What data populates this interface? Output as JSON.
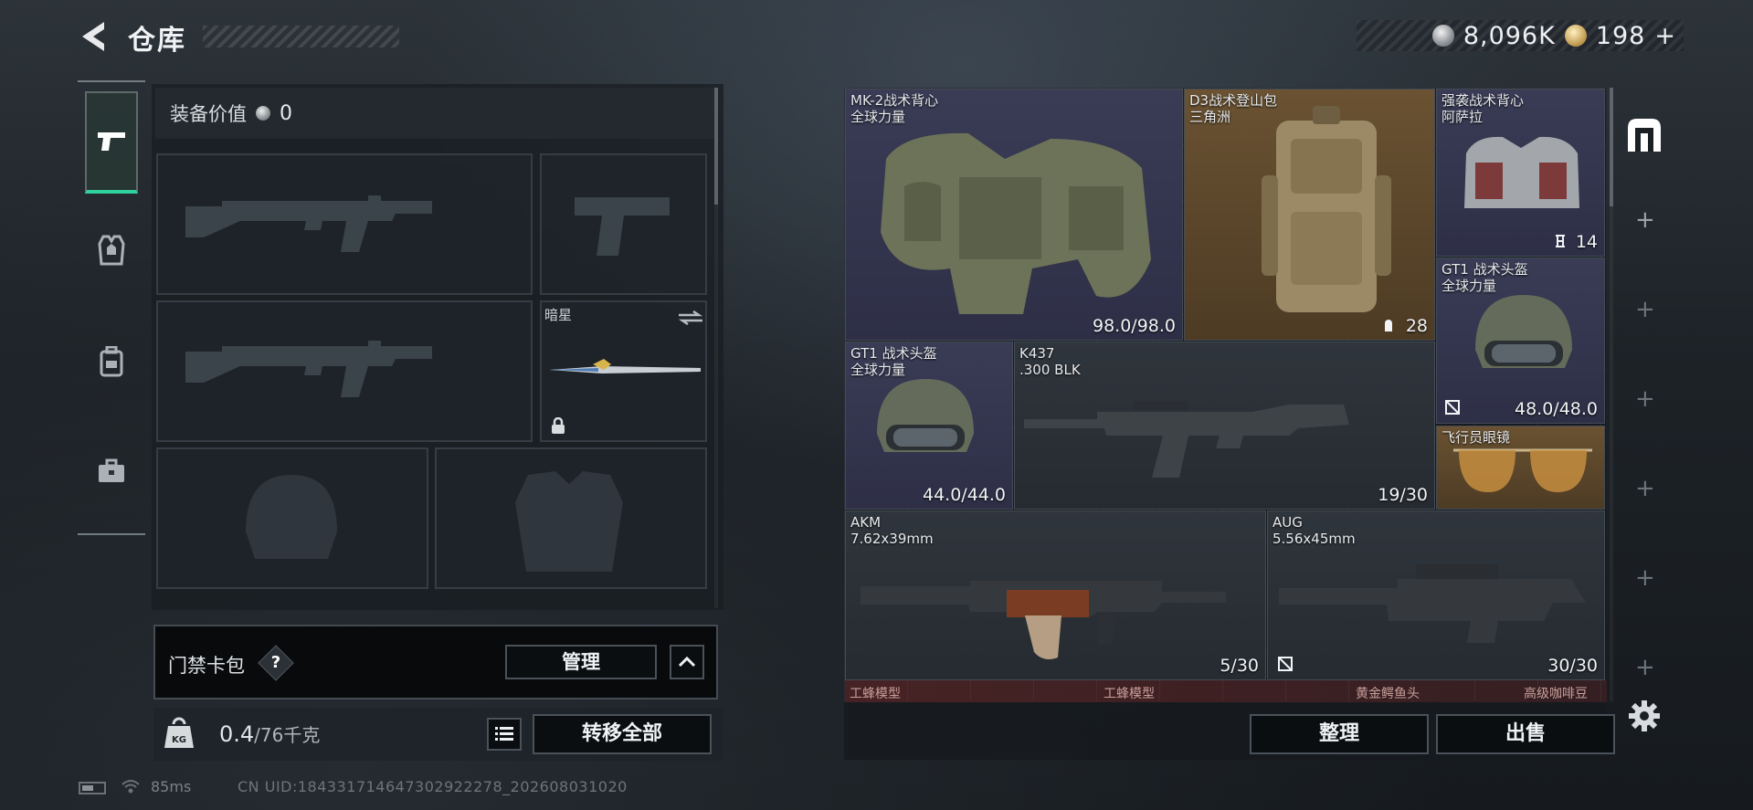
{
  "header": {
    "title": "仓库",
    "silver_amount": "8,096K",
    "gold_amount": "198",
    "gold_add": "+"
  },
  "sidebar": {
    "tabs": [
      {
        "name": "weapons",
        "icon": "pistol-icon",
        "active": true
      },
      {
        "name": "armor",
        "icon": "armor-vest-icon",
        "active": false
      },
      {
        "name": "backpack",
        "icon": "backpack-icon",
        "active": false
      },
      {
        "name": "toolbox",
        "icon": "toolbox-icon",
        "active": false
      }
    ]
  },
  "loadout": {
    "equip_value_label": "装备价值",
    "equip_value": "0",
    "melee_name": "暗星",
    "keycard_label": "门禁卡包",
    "help": "?",
    "manage_label": "管理",
    "weight_current": "0.4",
    "weight_capacity": "/76千克",
    "transfer_all_label": "转移全部"
  },
  "storage": {
    "items": [
      {
        "name": "MK-2战术背心",
        "sub": "全球力量",
        "value": "98.0/98.0"
      },
      {
        "name": "D3战术登山包",
        "sub": "三角洲",
        "value": "28"
      },
      {
        "name": "强袭战术背心",
        "sub": "阿萨拉",
        "value": "14"
      },
      {
        "name": "GT1 战术头盔",
        "sub": "全球力量",
        "value": "48.0/48.0"
      },
      {
        "name": "GT1 战术头盔",
        "sub": "全球力量",
        "value": "44.0/44.0"
      },
      {
        "name": "K437",
        "sub": ".300 BLK",
        "value": "19/30"
      },
      {
        "name": "飞行员眼镜",
        "sub": "",
        "value": ""
      },
      {
        "name": "AKM",
        "sub": "7.62x39mm",
        "value": "5/30"
      },
      {
        "name": "AUG",
        "sub": "5.56x45mm",
        "value": "30/30"
      }
    ],
    "row_tags": [
      "工蜂模型",
      "工蜂模型",
      "黄金鳄鱼头",
      "高级咖啡豆"
    ],
    "sort_label": "整理",
    "sell_label": "出售"
  },
  "status": {
    "ping": "85ms",
    "uid": "CN UID:18433171464730292227​8_202608031020"
  },
  "colors": {
    "accent_green": "#2fcf9e",
    "purple_rarity": "#3a3b55",
    "gold_rarity": "#6a5232"
  }
}
